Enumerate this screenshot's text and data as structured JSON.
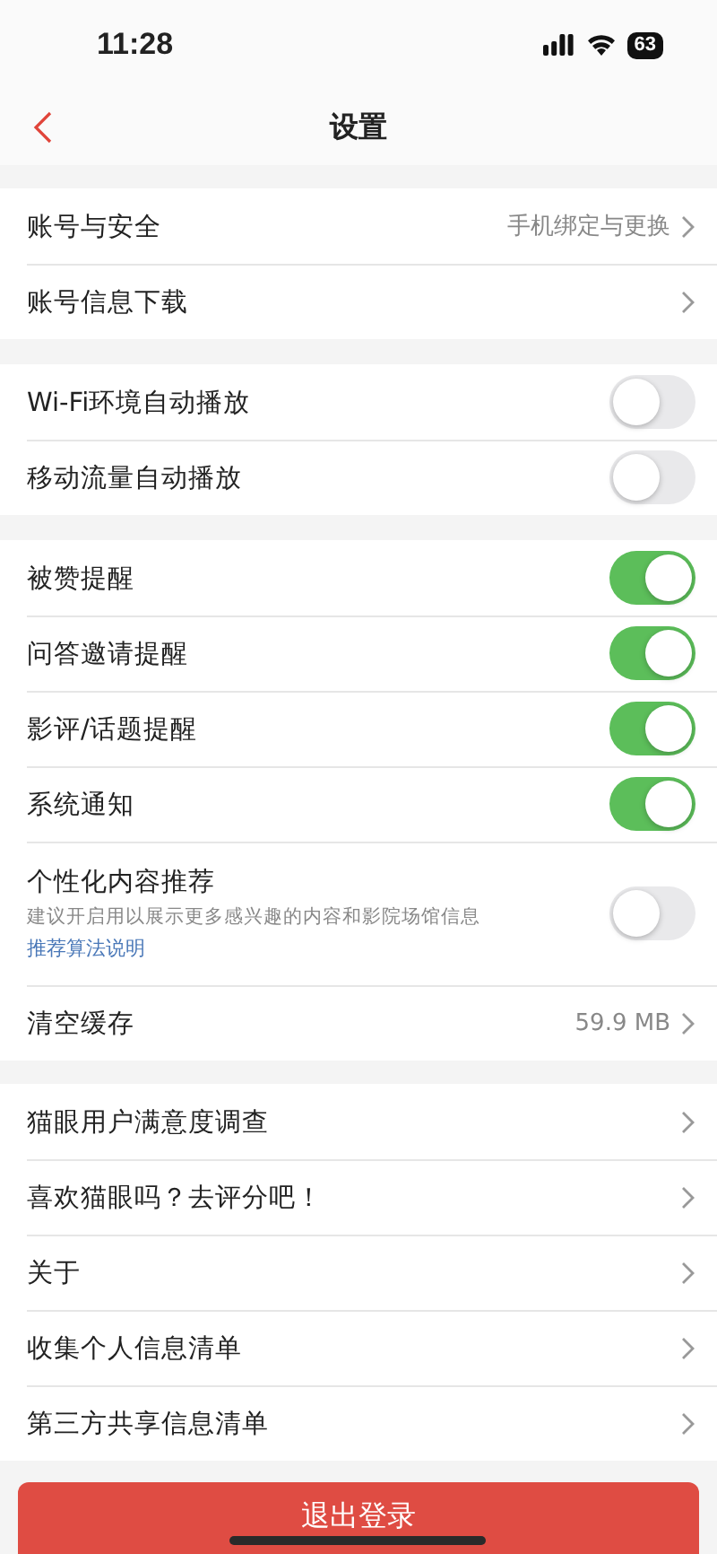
{
  "status_bar": {
    "time": "11:28",
    "battery": "63"
  },
  "nav": {
    "title": "设置"
  },
  "groups": [
    {
      "rows": [
        {
          "kind": "link",
          "label": "账号与安全",
          "value": "手机绑定与更换"
        },
        {
          "kind": "link",
          "label": "账号信息下载"
        }
      ]
    },
    {
      "rows": [
        {
          "kind": "toggle",
          "label": "Wi-Fi环境自动播放",
          "on": false
        },
        {
          "kind": "toggle",
          "label": "移动流量自动播放",
          "on": false
        }
      ]
    },
    {
      "rows": [
        {
          "kind": "toggle",
          "label": "被赞提醒",
          "on": true
        },
        {
          "kind": "toggle",
          "label": "问答邀请提醒",
          "on": true
        },
        {
          "kind": "toggle",
          "label": "影评/话题提醒",
          "on": true
        },
        {
          "kind": "toggle",
          "label": "系统通知",
          "on": true
        },
        {
          "kind": "toggle",
          "label": "个性化内容推荐",
          "description": "建议开启用以展示更多感兴趣的内容和影院场馆信息",
          "link": "推荐算法说明",
          "on": false
        },
        {
          "kind": "link",
          "label": "清空缓存",
          "value": "59.9 MB"
        }
      ]
    },
    {
      "rows": [
        {
          "kind": "link",
          "label": "猫眼用户满意度调查"
        },
        {
          "kind": "link",
          "label": "喜欢猫眼吗？去评分吧！"
        },
        {
          "kind": "link",
          "label": "关于"
        },
        {
          "kind": "link",
          "label": "收集个人信息清单"
        },
        {
          "kind": "link",
          "label": "第三方共享信息清单"
        }
      ]
    }
  ],
  "logout_button": "退出登录"
}
